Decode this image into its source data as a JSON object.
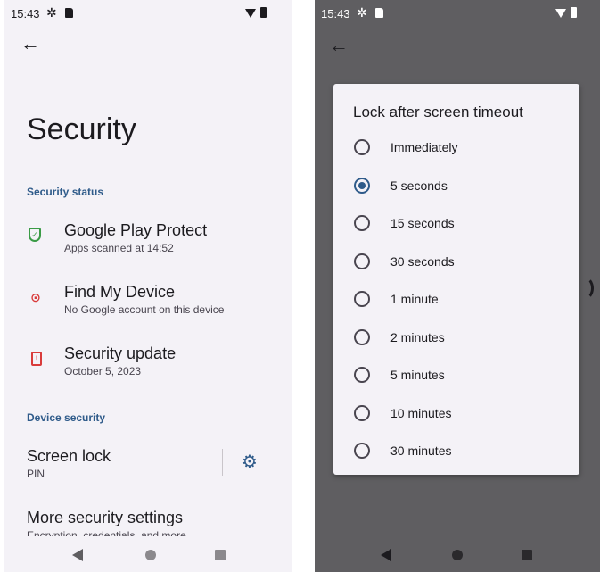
{
  "status_bar": {
    "time": "15:43"
  },
  "security_page": {
    "title": "Security",
    "section_status": "Security status",
    "items": [
      {
        "title": "Google Play Protect",
        "subtitle": "Apps scanned at 14:52"
      },
      {
        "title": "Find My Device",
        "subtitle": "No Google account on this device"
      },
      {
        "title": "Security update",
        "subtitle": "October 5, 2023"
      }
    ],
    "section_device": "Device security",
    "screen_lock": {
      "title": "Screen lock",
      "subtitle": "PIN"
    },
    "more_settings": {
      "title": "More security settings",
      "subtitle": "Encryption, credentials, and more"
    }
  },
  "dialog": {
    "title": "Lock after screen timeout",
    "selected_index": 1,
    "options": [
      "Immediately",
      "5 seconds",
      "15 seconds",
      "30 seconds",
      "1 minute",
      "2 minutes",
      "5 minutes",
      "10 minutes",
      "30 minutes"
    ]
  },
  "colors": {
    "accent": "#2f5b8a",
    "shield": "#3a9b46",
    "warning": "#d93b3b"
  }
}
